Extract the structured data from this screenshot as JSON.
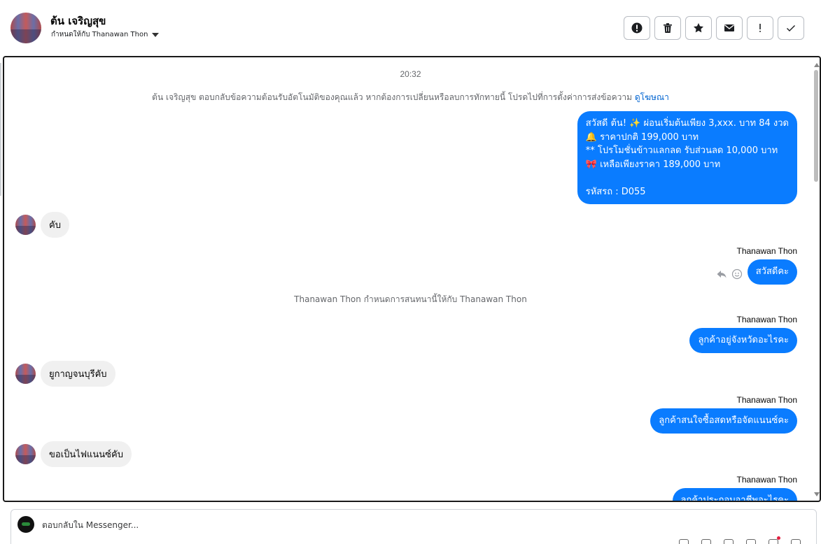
{
  "header": {
    "contact_name": "ต้น เจริญสุข",
    "assign_label": "กำหนดให้กับ Thanawan Thon"
  },
  "toolbar": [
    {
      "name": "spam-button",
      "icon": "alert-circle-icon"
    },
    {
      "name": "delete-button",
      "icon": "trash-icon"
    },
    {
      "name": "star-button",
      "icon": "star-icon"
    },
    {
      "name": "mark-unread-button",
      "icon": "envelope-icon"
    },
    {
      "name": "follow-up-button",
      "icon": "exclamation-icon"
    },
    {
      "name": "mark-done-button",
      "icon": "check-icon"
    }
  ],
  "chat": {
    "time": "20:32",
    "notice_text": "ต้น เจริญสุข ตอบกลับข้อความต้อนรับอัตโนมัติของคุณแล้ว หากต้องการเปลี่ยนหรือลบการทักทายนี้ โปรดไปที่การตั้งค่าการส่งข้อความ",
    "notice_link": "ดูโฆษณา",
    "messages": [
      {
        "dir": "out",
        "text": "สวัสดี ต้น! ✨  ผ่อนเริ่มต้นเพียง 3,xxx. บาท 84 งวด\n🔔 ราคาปกติ 199,000 บาท\n** โปรโมชั่นข้าวแลกลด รับส่วนลด 10,000 บาท\n🎀  เหลือเพียงราคา 189,000 บาท\n\nรหัสรถ : D055"
      },
      {
        "dir": "in",
        "text": "คับ"
      },
      {
        "dir": "out",
        "sender": "Thanawan Thon",
        "text": "สวัสดีคะ"
      },
      {
        "dir": "sys",
        "text": "Thanawan Thon กำหนดการสนทนานี้ให้กับ Thanawan Thon"
      },
      {
        "dir": "out",
        "sender": "Thanawan Thon",
        "text": "ลูกค้าอยู่จังหวัดอะไรคะ"
      },
      {
        "dir": "in",
        "text": "ยูกาญจนบุรีคับ"
      },
      {
        "dir": "out",
        "sender": "Thanawan Thon",
        "text": "ลูกค้าสนใจซื้อสดหรือจัดแนนซ์คะ"
      },
      {
        "dir": "in",
        "text": "ขอเป็นไฟแนนซ์คับ"
      },
      {
        "dir": "out",
        "sender": "Thanawan Thon",
        "text": "ลูกค้าประกอบอาชีพอะไรคะ"
      }
    ]
  },
  "composer": {
    "placeholder": "ตอบกลับใน Messenger..."
  }
}
